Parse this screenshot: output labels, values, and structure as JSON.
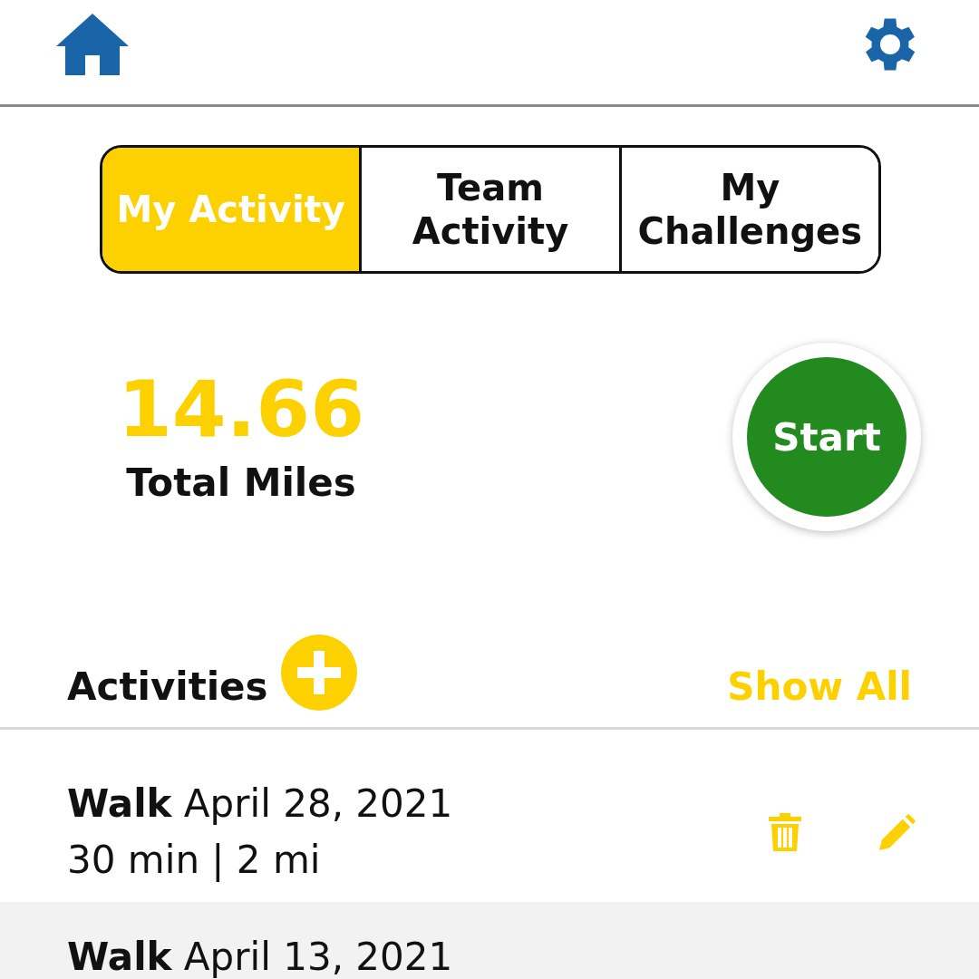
{
  "tabs": [
    {
      "label": "My Activity",
      "selected": true
    },
    {
      "label": "Team Activity",
      "selected": false
    },
    {
      "label": "My Challenges",
      "selected": false
    }
  ],
  "total": {
    "value": "14.66",
    "label": "Total Miles"
  },
  "start_button": "Start",
  "activities": {
    "title": "Activities",
    "show_all": "Show All",
    "items": [
      {
        "type": "Walk",
        "date": "April 28, 2021",
        "details": "30 min | 2 mi",
        "shaded": false
      },
      {
        "type": "Walk",
        "date": "April 13, 2021",
        "shaded": true
      }
    ]
  }
}
